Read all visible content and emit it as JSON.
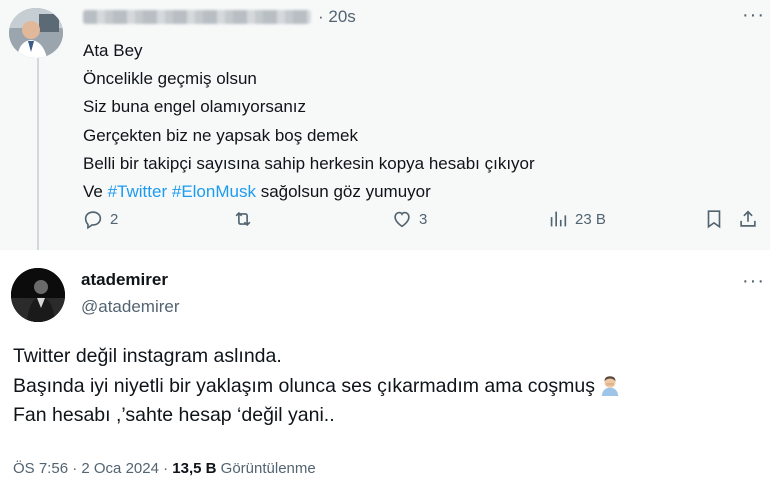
{
  "reply": {
    "time": "· 20s",
    "more": "···",
    "lines": [
      "Ata Bey",
      "Öncelikle geçmiş olsun",
      "Siz buna engel olamıyorsanız",
      "Gerçekten biz ne yapsak boş demek",
      "Belli bir takipçi sayısına sahip herkesin kopya hesabı çıkıyor"
    ],
    "last_line": {
      "prefix": "Ve ",
      "hashtag1": "#Twitter",
      "space": " ",
      "hashtag2": "#ElonMusk",
      "suffix": " sağolsun göz yumuyor"
    },
    "actions": {
      "replies": "2",
      "retweets": "",
      "likes": "3",
      "views": "23 B"
    }
  },
  "tweet": {
    "display_name": "atademirer",
    "handle": "@atademirer",
    "more": "···",
    "lines": [
      "Twitter değil instagram aslında.",
      "Başında iyi niyetli bir yaklaşım olunca ses çıkarmadım ama coşmuş",
      "Fan hesabı ,’sahte hesap ‘değil yani.."
    ],
    "emoji": "man-facepalming-emoji",
    "meta": {
      "time": "ÖS 7:56",
      "date": "· 2 Oca 2024 ·",
      "views_count": "13,5 B",
      "views_label": "Görüntülenme"
    }
  },
  "colors": {
    "accent": "#1d9bf0",
    "text": "#0f1419",
    "secondary": "#536471",
    "reply_bg": "#f7f9f9"
  },
  "icons": [
    "reply-icon",
    "retweet-icon",
    "like-icon",
    "views-icon",
    "bookmark-icon",
    "share-icon",
    "more-icon"
  ]
}
